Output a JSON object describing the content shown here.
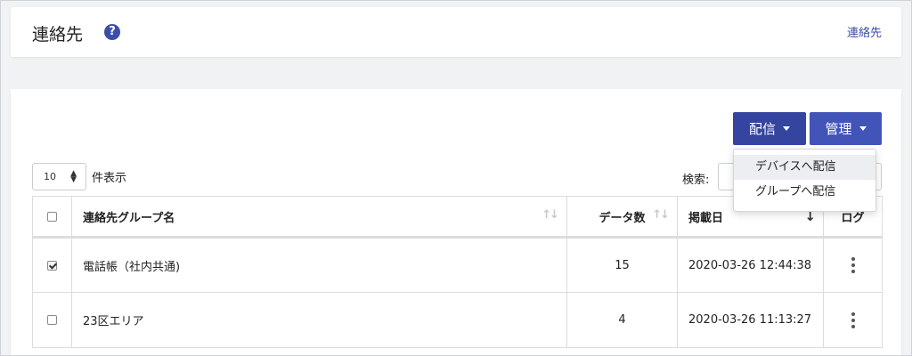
{
  "header": {
    "title": "連絡先",
    "help_icon": "?",
    "breadcrumb": "連絡先"
  },
  "toolbar": {
    "distribute_label": "配信",
    "manage_label": "管理"
  },
  "dropdown": {
    "items": [
      "デバイスへ配信",
      "グループへ配信"
    ]
  },
  "length": {
    "value": "10",
    "label": "件表示"
  },
  "search": {
    "label": "検索:",
    "value": ""
  },
  "table": {
    "columns": [
      "連絡先グループ名",
      "データ数",
      "掲載日",
      "ログ"
    ],
    "rows": [
      {
        "checked": true,
        "name": "電話帳（社内共通)",
        "count": "15",
        "date": "2020-03-26 12:44:38"
      },
      {
        "checked": false,
        "name": "23区エリア",
        "count": "4",
        "date": "2020-03-26 11:13:27"
      }
    ]
  },
  "colors": {
    "accent": "#3a4aa8",
    "link": "#3c4fa8",
    "background": "#f1f2f4"
  }
}
